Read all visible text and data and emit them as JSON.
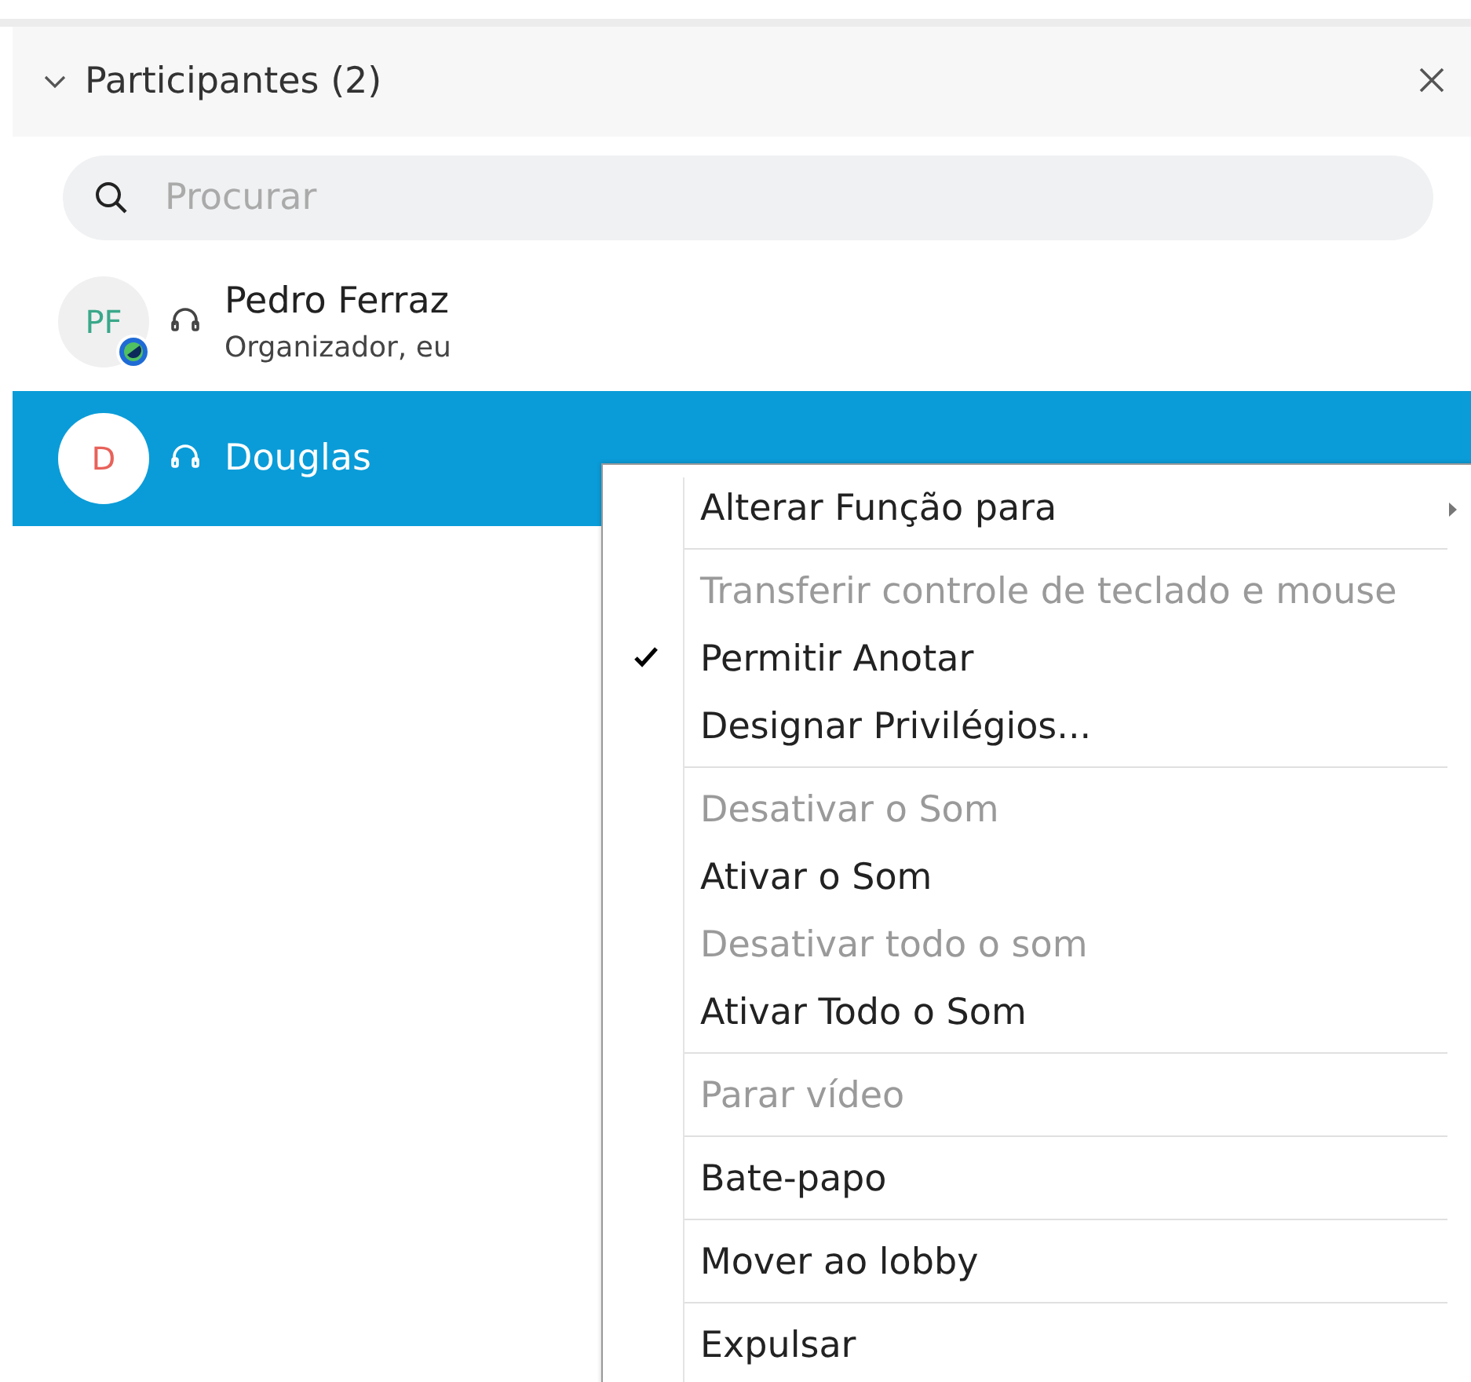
{
  "panel": {
    "title": "Participantes (2)",
    "expanded": true
  },
  "search": {
    "placeholder": "Procurar"
  },
  "participants": [
    {
      "initials": "PF",
      "name": "Pedro Ferraz",
      "role": "Organizador, eu",
      "selected": false,
      "host": true
    },
    {
      "initials": "D",
      "name": "Douglas",
      "selected": true,
      "host": false
    }
  ],
  "context_menu": [
    {
      "kind": "item",
      "label": "Alterar Função para",
      "disabled": false,
      "checked": false,
      "submenu": true
    },
    {
      "kind": "separator"
    },
    {
      "kind": "item",
      "label": "Transferir controle de teclado e mouse",
      "disabled": true,
      "checked": false,
      "submenu": false
    },
    {
      "kind": "item",
      "label": "Permitir Anotar",
      "disabled": false,
      "checked": true,
      "submenu": false
    },
    {
      "kind": "item",
      "label": "Designar Privilégios...",
      "disabled": false,
      "checked": false,
      "submenu": false
    },
    {
      "kind": "separator"
    },
    {
      "kind": "item",
      "label": "Desativar o Som",
      "disabled": true,
      "checked": false,
      "submenu": false
    },
    {
      "kind": "item",
      "label": "Ativar o Som",
      "disabled": false,
      "checked": false,
      "submenu": false
    },
    {
      "kind": "item",
      "label": "Desativar todo o som",
      "disabled": true,
      "checked": false,
      "submenu": false
    },
    {
      "kind": "item",
      "label": "Ativar Todo o Som",
      "disabled": false,
      "checked": false,
      "submenu": false
    },
    {
      "kind": "separator"
    },
    {
      "kind": "item",
      "label": "Parar vídeo",
      "disabled": true,
      "checked": false,
      "submenu": false
    },
    {
      "kind": "separator"
    },
    {
      "kind": "item",
      "label": "Bate-papo",
      "disabled": false,
      "checked": false,
      "submenu": false
    },
    {
      "kind": "separator"
    },
    {
      "kind": "item",
      "label": "Mover ao lobby",
      "disabled": false,
      "checked": false,
      "submenu": false
    },
    {
      "kind": "separator"
    },
    {
      "kind": "item",
      "label": "Expulsar",
      "disabled": false,
      "checked": false,
      "submenu": false
    }
  ]
}
